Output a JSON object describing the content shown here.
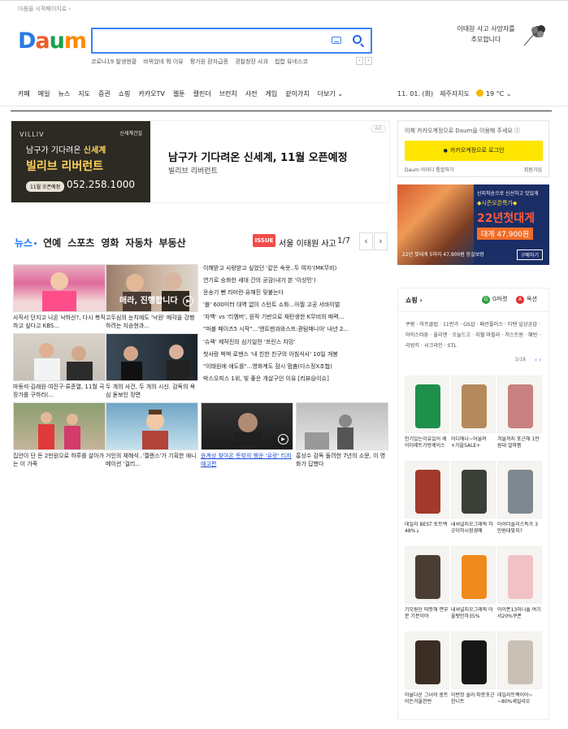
{
  "topbar": {
    "start_page": "다음을 시작페이지로 ›"
  },
  "logo": {
    "letters": [
      "D",
      "a",
      "u",
      "m"
    ],
    "colors": [
      "#2a7ae2",
      "#ef5b2b",
      "#16a34a",
      "#ff8a00"
    ]
  },
  "search": {
    "value": "",
    "placeholder": ""
  },
  "trending": [
    "코로나19 발생현황",
    "바뀌었네 뭐 이유",
    "평가원 환자급증",
    "경찰청장 사과",
    "힙합 유네스코"
  ],
  "memorial": {
    "line1": "이태원 사고 사망자를",
    "line2": "추모합니다"
  },
  "gnb": {
    "items": [
      "카페",
      "메일",
      "뉴스",
      "지도",
      "증권",
      "쇼핑",
      "카카오TV",
      "웹툰",
      "캘린더",
      "브런치",
      "사전",
      "게임",
      "같이가치",
      "더보기"
    ],
    "date": "11. 01. (화)",
    "location": "제주자치도",
    "temp": "19 °C ⌄"
  },
  "ad": {
    "villiv": "VILLIV",
    "brand": "신세계건설",
    "img_line1a": "남구가 기다려온 ",
    "img_line1b": "신세계",
    "img_line2": "빌리브 리버런트",
    "img_pill": "11월 오픈예정",
    "img_phone": "052.258.1000",
    "title": "남구가 기다려온 신세계, 11월 오픈예정",
    "subtitle": "빌리브 리버런트",
    "label": "AD"
  },
  "login": {
    "desc": "이제 카카오계정으로 Daum을 이용해 주세요 ⓘ",
    "button": "카카오계정으로 로그인",
    "daum_id": "Daum 아이디 통합하기",
    "join": "회원가입"
  },
  "side_ad": {
    "t1": "산지직송으로 신선하고 맛있게",
    "t2": "◆시즌오픈특가◆",
    "t3": "22년첫대게",
    "t4": "대게 47,900원",
    "t5": "22년 첫대게 5미리 47,900원 등실보장",
    "buy": "구매하기"
  },
  "news": {
    "tabs": [
      "뉴스",
      "연예",
      "스포츠",
      "영화",
      "자동차",
      "부동산"
    ],
    "issue_label": "ISSUE",
    "issue_title": "서울 이태원 사고",
    "pager": "1/7",
    "overlay": "매라, 진행합니다",
    "cards": [
      {
        "caption": "사직서 던지고 나온 낙하산?, 다시 복직하고 싶다고 KBS..."
      },
      {
        "caption": "고두심의 눈치에도 '낙원' 매각을 강행하려는 지승현과..."
      },
      {
        "caption": "마동석·김래원·여진구·류준열, 11월 극장가를 구하라(..."
      },
      {
        "caption": "두 개의 사건, 두 개의 시신. 감독의 욕심 돋보인 장면"
      },
      {
        "caption": "집안이 단 돈 2만원으로 하루를 살아가는 이 가족"
      },
      {
        "caption": "거인의 재해석..'젤랜스'가 기획한 애니메이션 '걸리..."
      },
      {
        "caption": "윤계상 찾아온 뜻밖의 행운 '유랑' 티저 예고편"
      },
      {
        "caption": "홍상수 감독 돌려한 7년의 소문, 이 영화가 답했다"
      }
    ],
    "list": [
      "이해받고 사랑받고 싶었던 '같은 속옷..두 여자'(MK무비)",
      "연기로 승화한 세대 간의 공감(내가 본 '이성민')",
      "운송기 뺀 라미란·유해진 맞붙는다",
      "'블' 600미터 대역 없이 스턴트 소화...아찔 고공 서바이벌",
      "'자백' vs '리멤버', 원작 기반으로 재탄생한 K무비의 매력...",
      "\"마블 페이즈5 시작\"...'앤트맨과와스프:퀀텀매니아' 내년 2...",
      "'슈렉' 제작진의 심기일전 '프린스 차밍'",
      "첫사랑 벅벅 로맨스 '내 친한 친구의 아침식사' 10일 개봉",
      "\"이태원에 애도를\"...영화계도 잠시 멈춤(다스정X조협)",
      "박스오피스 1위, 빛 좋은 개살구인 이유 [리뷰@이슈]"
    ]
  },
  "shopping": {
    "title": "쇼핑",
    "gmarket": "G마켓",
    "auction": "옥션",
    "categories": "쿠팡 · 하프클럽 · 11번가 · GS샵 · 패션플러스 · 티텐 일상공감 · 아이스타툰 · 올리앤 · 오늘드고 · 지월 마필라 · 저스트원 · 혜빈 · 리빙킥 · 시크라인 · STL",
    "page": "3/18",
    "products": [
      "인기있는이유있어 레이더레트가방케이스",
      "어디에나~어울려 +가을SALE+",
      "겨울까지 포근해 1만원대 얼마쯤",
      "데일리 BEST 토트백 48%↓",
      "내셔널지오그래픽 하굿이하시장경매",
      "아이더플리스특가 3만원대맞지?",
      "기모원단 따뜻해 면부문 기분이야",
      "내셔널지오그래픽 아울렛인하35%",
      "아이폰13미니풀 여기서20%쿠폰",
      "아울다운 그녀의 롱트이든거울한번",
      "이번창 플라 따뜻포근한니트",
      "데일리트랙이아~ ~80%세일라오"
    ],
    "product_colors": [
      "#1f8f4c",
      "#b48a5c",
      "#c98080",
      "#a13a2c",
      "#3a3f38",
      "#7f8891",
      "#4a3d33",
      "#f08a1c",
      "#f0c2c6",
      "#3c2e24",
      "#171717",
      "#c9c0b5"
    ]
  }
}
